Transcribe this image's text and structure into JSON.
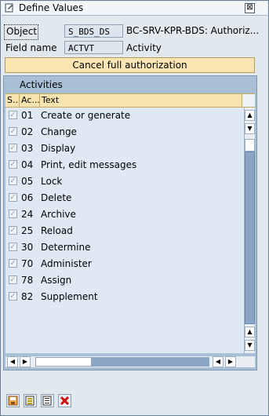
{
  "window": {
    "title": "Define Values",
    "close_symbol": "⊠"
  },
  "header": {
    "object_label": "Object",
    "object_value": "S_BDS_DS",
    "object_desc": "BC-SRV-KPR-BDS: Authoriz...",
    "field_label": "Field name",
    "field_value": "ACTVT",
    "field_desc": "Activity"
  },
  "cancel_button": "Cancel full authorization",
  "table": {
    "title": "Activities",
    "columns": [
      "S..",
      "Ac...",
      "Text"
    ],
    "rows": [
      {
        "code": "01",
        "text": "Create or generate"
      },
      {
        "code": "02",
        "text": "Change"
      },
      {
        "code": "03",
        "text": "Display"
      },
      {
        "code": "04",
        "text": "Print, edit messages"
      },
      {
        "code": "05",
        "text": "Lock"
      },
      {
        "code": "06",
        "text": "Delete"
      },
      {
        "code": "24",
        "text": "Archive"
      },
      {
        "code": "25",
        "text": "Reload"
      },
      {
        "code": "30",
        "text": "Determine"
      },
      {
        "code": "70",
        "text": "Administer"
      },
      {
        "code": "78",
        "text": "Assign"
      },
      {
        "code": "82",
        "text": "Supplement"
      }
    ],
    "checked_symbol": "✓",
    "scroll_up": "▲",
    "scroll_down": "▼",
    "scroll_left": "◀",
    "scroll_right": "▶"
  },
  "toolbar": {
    "icons": [
      "save-icon",
      "select-all-icon",
      "deselect-icon",
      "cancel-icon"
    ]
  }
}
